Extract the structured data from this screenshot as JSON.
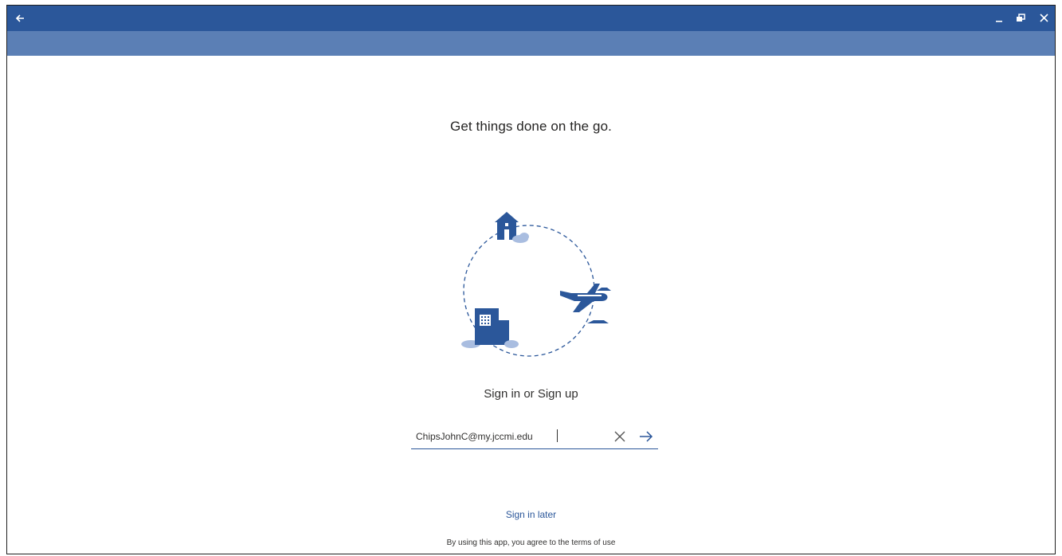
{
  "window": {
    "back_icon": "arrow-left-icon",
    "minimize_icon": "minimize-icon",
    "restore_icon": "restore-icon",
    "close_icon": "close-icon",
    "expand_icon": "chevron-down-icon",
    "titlebar_color": "#2b579a",
    "subbar_color": "#5b7fb5"
  },
  "main": {
    "headline": "Get things done on the go.",
    "illustration_icons": [
      "house-icon",
      "office-building-icon",
      "airplane-icon",
      "cloud-icon"
    ]
  },
  "signin": {
    "title": "Sign in or Sign up",
    "email_value": "ChipsJohnC@my.jccmi.edu",
    "clear_icon": "close-icon",
    "submit_icon": "arrow-right-icon",
    "accent_color": "#2b579a"
  },
  "footer": {
    "sign_in_later": "Sign in later",
    "terms": "By using this app, you agree to the terms of use"
  }
}
